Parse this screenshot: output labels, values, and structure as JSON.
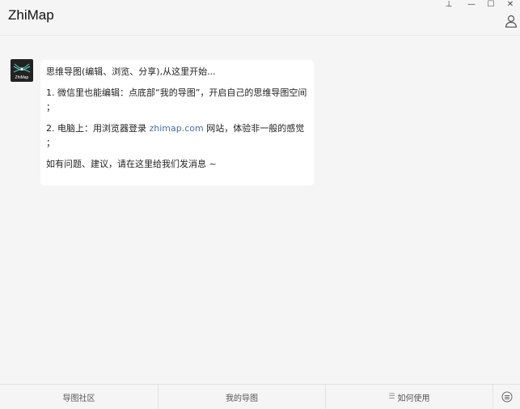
{
  "window": {
    "title": "ZhiMap",
    "pin_glyph": "⊥",
    "min_glyph": "—",
    "max_glyph": "☐",
    "close_glyph": "✕"
  },
  "header": {
    "user_icon": "user-icon"
  },
  "message": {
    "avatar_label": "ZhiMap",
    "line1": "思维导图(编辑、浏览、分享),从这里开始...",
    "line2": "1. 微信里也能编辑：点底部“我的导图”，开启自己的思维导图空间",
    "line2_tail": "；",
    "line3_prefix": "2. 电脑上：用浏览器登录 ",
    "line3_link": "zhimap.com",
    "line3_suffix": " 网站，体验非一般的感觉",
    "line3_tail": "；",
    "line4": "如有问题、建议，请在这里给我们发消息 ~"
  },
  "bottom_tabs": {
    "tab1": "导图社区",
    "tab2": "我的导图",
    "tab3": "如何使用",
    "tab3_icon": "menu-icon"
  },
  "colors": {
    "link": "#4a6fa5",
    "bubble": "#ffffff",
    "background": "#f5f5f5"
  }
}
